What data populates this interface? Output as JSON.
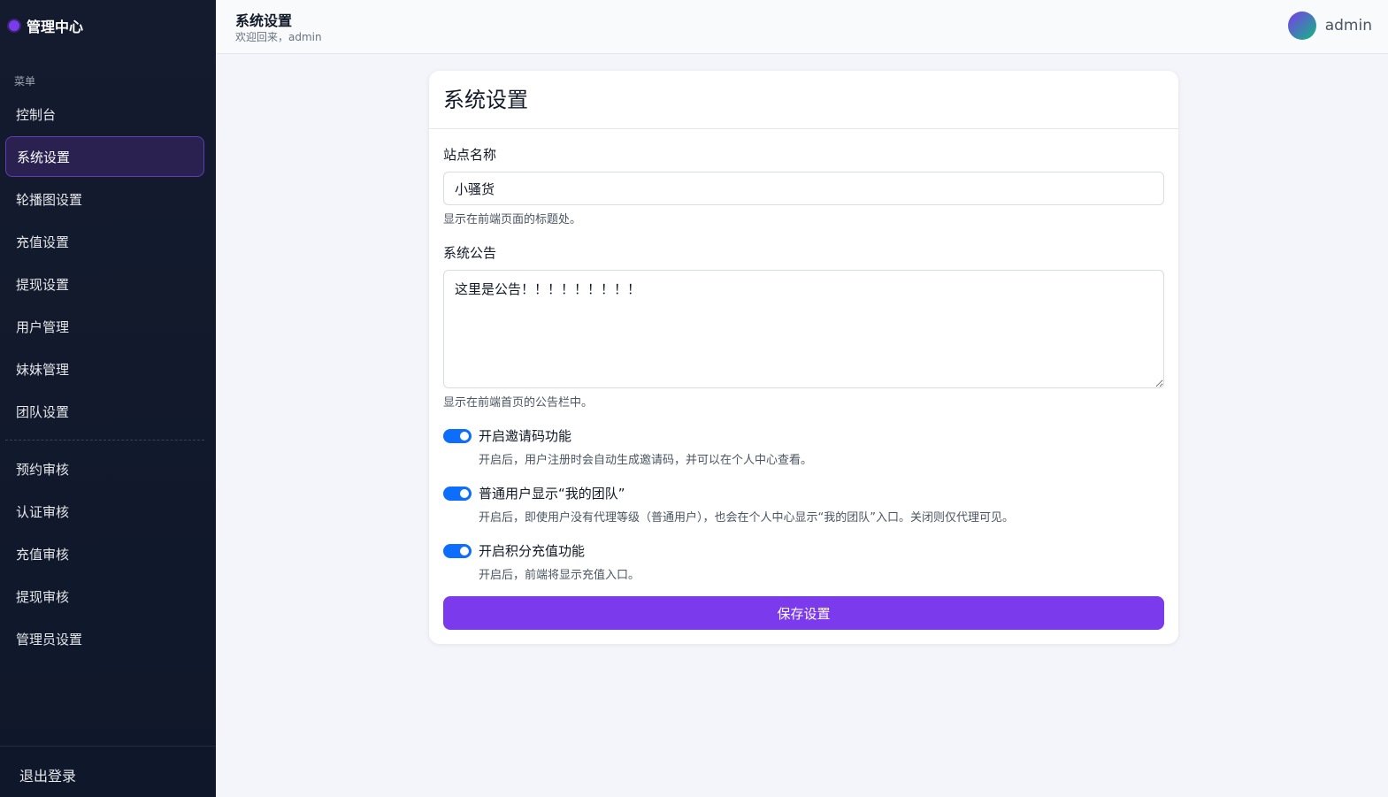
{
  "sidebar": {
    "brand": "管理中心",
    "menu_caption": "菜单",
    "items_group1": [
      {
        "label": "控制台",
        "name": "sidebar-item-dashboard",
        "active": false
      },
      {
        "label": "系统设置",
        "name": "sidebar-item-system-settings",
        "active": true
      },
      {
        "label": "轮播图设置",
        "name": "sidebar-item-carousel-settings",
        "active": false
      },
      {
        "label": "充值设置",
        "name": "sidebar-item-recharge-settings",
        "active": false
      },
      {
        "label": "提现设置",
        "name": "sidebar-item-withdraw-settings",
        "active": false
      },
      {
        "label": "用户管理",
        "name": "sidebar-item-user-management",
        "active": false
      },
      {
        "label": "妹妹管理",
        "name": "sidebar-item-sister-management",
        "active": false
      },
      {
        "label": "团队设置",
        "name": "sidebar-item-team-settings",
        "active": false
      }
    ],
    "items_group2": [
      {
        "label": "预约审核",
        "name": "sidebar-item-booking-review",
        "active": false
      },
      {
        "label": "认证审核",
        "name": "sidebar-item-verification-review",
        "active": false
      },
      {
        "label": "充值审核",
        "name": "sidebar-item-recharge-review",
        "active": false
      },
      {
        "label": "提现审核",
        "name": "sidebar-item-withdraw-review",
        "active": false
      },
      {
        "label": "管理员设置",
        "name": "sidebar-item-admin-settings",
        "active": false
      }
    ],
    "logout": "退出登录"
  },
  "header": {
    "title": "系统设置",
    "welcome": "欢迎回来，admin",
    "username": "admin"
  },
  "form": {
    "card_title": "系统设置",
    "site_name": {
      "label": "站点名称",
      "value": "小骚货",
      "help": "显示在前端页面的标题处。"
    },
    "announcement": {
      "label": "系统公告",
      "value": "这里是公告！！！！！！！！！",
      "help": "显示在前端首页的公告栏中。"
    },
    "toggles": [
      {
        "label": "开启邀请码功能",
        "desc": "开启后，用户注册时会自动生成邀请码，并可以在个人中心查看。",
        "on": true
      },
      {
        "label": "普通用户显示“我的团队”",
        "desc": "开启后，即使用户没有代理等级（普通用户），也会在个人中心显示“我的团队”入口。关闭则仅代理可见。",
        "on": true
      },
      {
        "label": "开启积分充值功能",
        "desc": "开启后，前端将显示充值入口。",
        "on": true
      }
    ],
    "save_label": "保存设置"
  },
  "colors": {
    "accent": "#7c3aed",
    "toggle_on": "#0d6efd",
    "sidebar_bg": "#0f172a"
  }
}
